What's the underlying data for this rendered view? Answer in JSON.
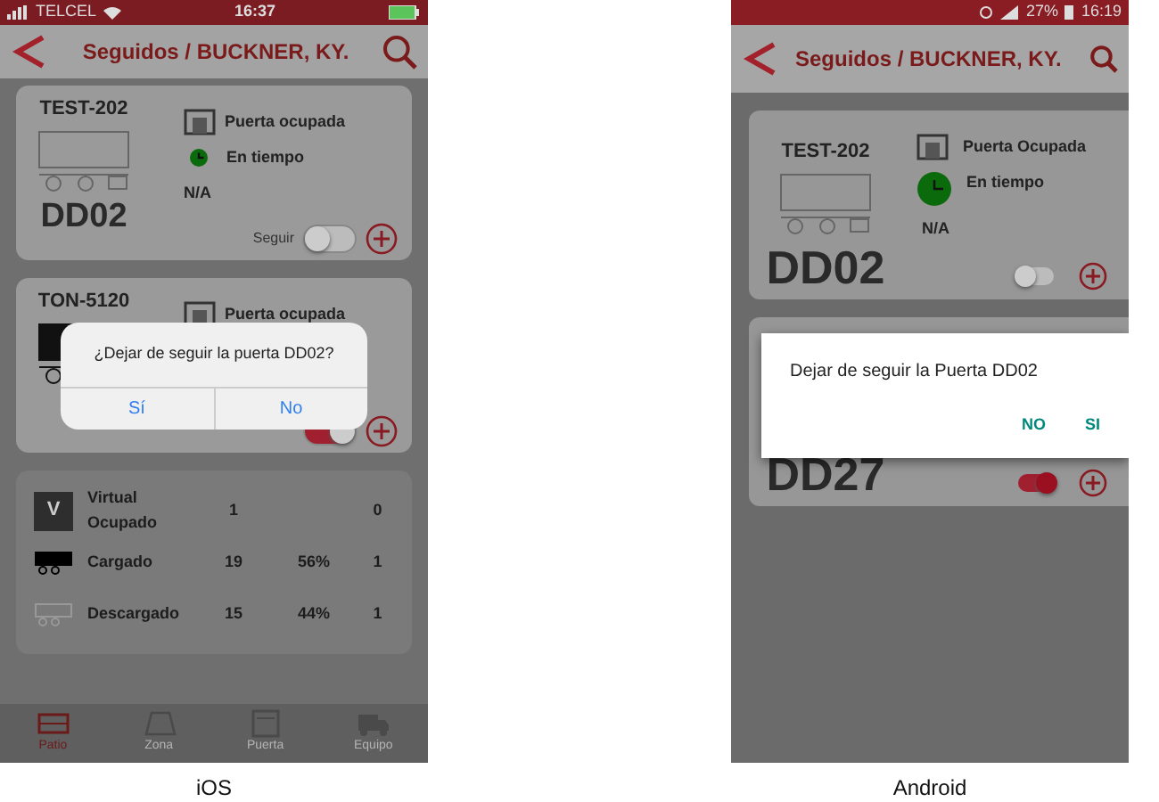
{
  "phones": [
    {
      "kind": "ios",
      "caption": "iOS",
      "status_bar": {
        "carrier": "TELCEL",
        "time": "16:37"
      },
      "header": {
        "title": "Seguidos / BUCKNER, KY."
      },
      "cards": [
        {
          "trailer": "TEST-202",
          "door_status": "Puerta ocupada",
          "timing": "En tiempo",
          "eta": "N/A",
          "door": "DD02",
          "follow_label": "Seguir",
          "following": false
        },
        {
          "trailer": "TON-5120",
          "door_status": "Puerta ocupada",
          "following": true
        }
      ],
      "summary": [
        {
          "kind": "virtual",
          "letter": "V",
          "label": "Virtual Ocupado",
          "count": "1",
          "total": "0"
        },
        {
          "kind": "loaded",
          "label": "Cargado",
          "count": "19",
          "share": "56%",
          "total": "1"
        },
        {
          "kind": "empty",
          "label": "Descargado",
          "count": "15",
          "share": "44%",
          "total": "1"
        }
      ],
      "dialog": {
        "message": "¿Dejar de seguir la puerta DD02?",
        "buttons": [
          "Sí",
          "No"
        ]
      },
      "tabs": [
        {
          "label": "Patio",
          "kind": "yard",
          "selected": true
        },
        {
          "label": "Zona",
          "kind": "zone",
          "selected": false
        },
        {
          "label": "Puerta",
          "kind": "door",
          "selected": false
        },
        {
          "label": "Equipo",
          "kind": "truck",
          "selected": false
        }
      ]
    },
    {
      "kind": "android",
      "caption": "Android",
      "status_bar": {
        "battery": "27%",
        "time": "16:19"
      },
      "header": {
        "title": "Seguidos / BUCKNER, KY."
      },
      "cards": [
        {
          "trailer": "TEST-202",
          "door_status": "Puerta Ocupada",
          "timing": "En tiempo",
          "eta": "N/A",
          "door": "DD02",
          "following": false
        },
        {
          "door": "DD27",
          "following": true
        }
      ],
      "dialog": {
        "message": "Dejar de seguir la Puerta DD02",
        "buttons": [
          "NO",
          "SI"
        ]
      }
    }
  ]
}
